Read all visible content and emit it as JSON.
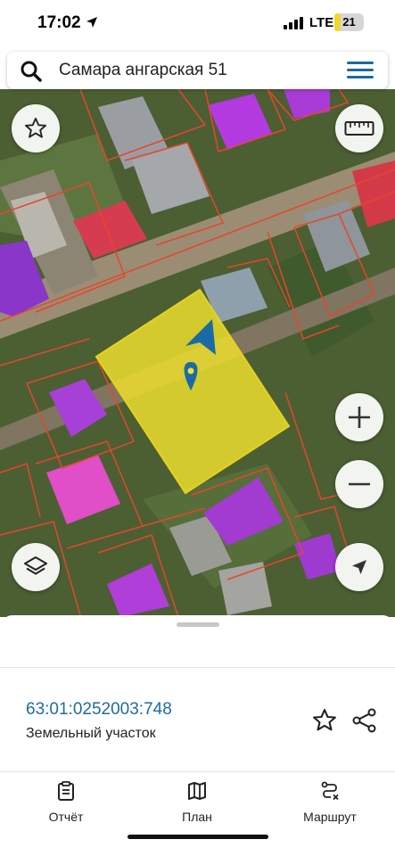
{
  "status": {
    "time": "17:02",
    "network": "LTE",
    "battery": "21",
    "battery_level": 0.21
  },
  "search": {
    "query": "Самара ангарская 51"
  },
  "map": {
    "buttons": {
      "favorite": "star-icon",
      "ruler": "ruler-icon",
      "zoom_in": "+",
      "zoom_out": "−",
      "layers": "layers-icon",
      "locate": "navigation-arrow-icon"
    },
    "colors": {
      "selected_parcel": "#f2e22c",
      "parcel_border": "#e8452c",
      "roof_magenta": "#b33adf",
      "roof_red": "#d63c4f",
      "marker": "#1a6aa6"
    }
  },
  "parcel": {
    "cadastral_number": "63:01:0252003:748",
    "type": "Земельный участок"
  },
  "tabs": [
    {
      "label": "Отчёт",
      "icon": "report-icon"
    },
    {
      "label": "План",
      "icon": "map-plan-icon"
    },
    {
      "label": "Маршрут",
      "icon": "route-icon"
    }
  ]
}
